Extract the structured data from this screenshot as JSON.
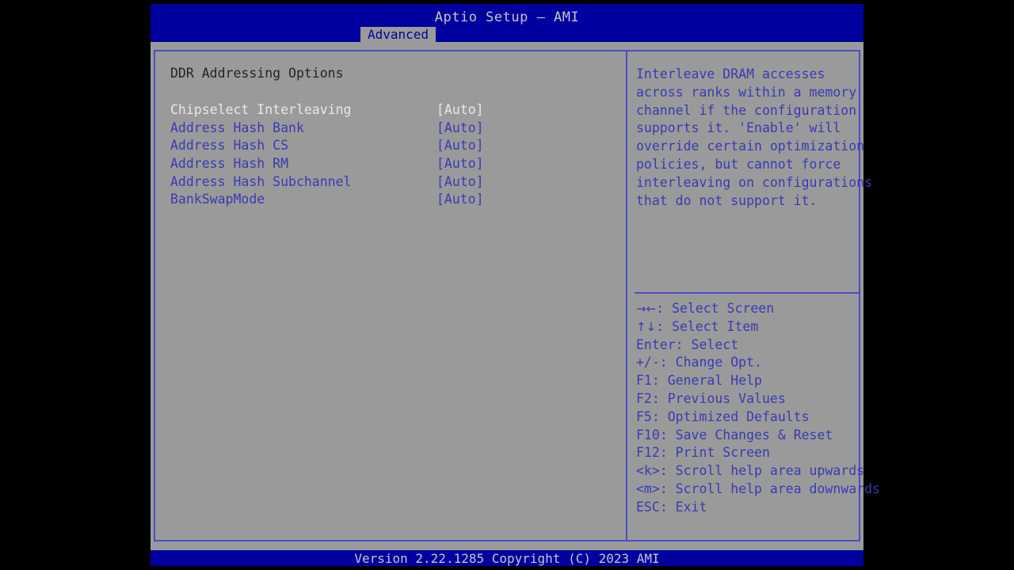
{
  "window": {
    "title": "Aptio Setup – AMI",
    "background_color": "#00009e",
    "panel_color": "#9a9a9a",
    "accent_color": "#3a3ab4",
    "selected_color": "#e8e8e8"
  },
  "tabs": [
    {
      "label": "Advanced",
      "active": true
    }
  ],
  "main": {
    "section_title": "DDR Addressing Options",
    "options": [
      {
        "label": "Chipselect Interleaving",
        "value": "[Auto]",
        "selected": true
      },
      {
        "label": "Address Hash Bank",
        "value": "[Auto]",
        "selected": false
      },
      {
        "label": "Address Hash CS",
        "value": "[Auto]",
        "selected": false
      },
      {
        "label": "Address Hash RM",
        "value": "[Auto]",
        "selected": false
      },
      {
        "label": "Address Hash Subchannel",
        "value": "[Auto]",
        "selected": false
      },
      {
        "label": "BankSwapMode",
        "value": "[Auto]",
        "selected": false
      }
    ]
  },
  "help": {
    "lines": [
      "Interleave DRAM accesses",
      "across ranks within a memory",
      "channel if the configuration",
      "supports it. 'Enable' will",
      "override certain optimization",
      "policies, but cannot force",
      "interleaving on configurations",
      "that do not support it."
    ]
  },
  "hotkeys": [
    {
      "key": "→←",
      "icon": "arrows-horizontal-icon",
      "text": ": Select Screen"
    },
    {
      "key": "↑↓",
      "icon": "arrows-vertical-icon",
      "text": ": Select Item"
    },
    {
      "key": "Enter",
      "icon": "",
      "text": ": Select"
    },
    {
      "key": "+/-",
      "icon": "",
      "text": ": Change Opt."
    },
    {
      "key": "F1",
      "icon": "",
      "text": ": General Help"
    },
    {
      "key": "F2",
      "icon": "",
      "text": ": Previous Values"
    },
    {
      "key": "F5",
      "icon": "",
      "text": ": Optimized Defaults"
    },
    {
      "key": "F10",
      "icon": "",
      "text": ": Save Changes & Reset"
    },
    {
      "key": "F12",
      "icon": "",
      "text": ": Print Screen"
    },
    {
      "key": "<k>",
      "icon": "",
      "text": ": Scroll help area upwards"
    },
    {
      "key": "<m>",
      "icon": "",
      "text": ": Scroll help area downwards"
    },
    {
      "key": "ESC",
      "icon": "",
      "text": ": Exit"
    }
  ],
  "footer": {
    "version_text": "Version 2.22.1285 Copyright (C) 2023 AMI"
  }
}
